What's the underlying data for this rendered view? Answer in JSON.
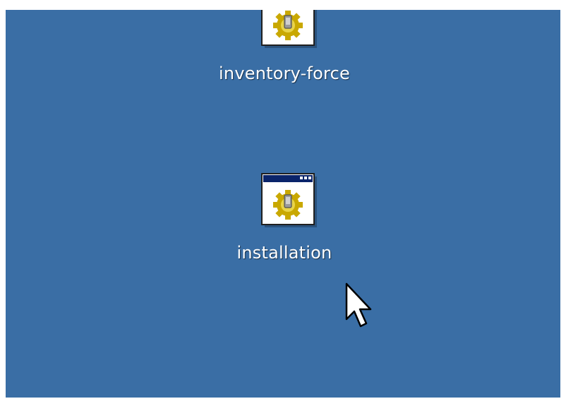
{
  "desktop": {
    "background_color": "#3a6ea5",
    "icons": [
      {
        "label": "inventory-force",
        "icon": "application-gear-icon"
      },
      {
        "label": "installation",
        "icon": "application-gear-icon"
      }
    ]
  },
  "cursor": {
    "icon": "arrow-pointer-icon"
  }
}
